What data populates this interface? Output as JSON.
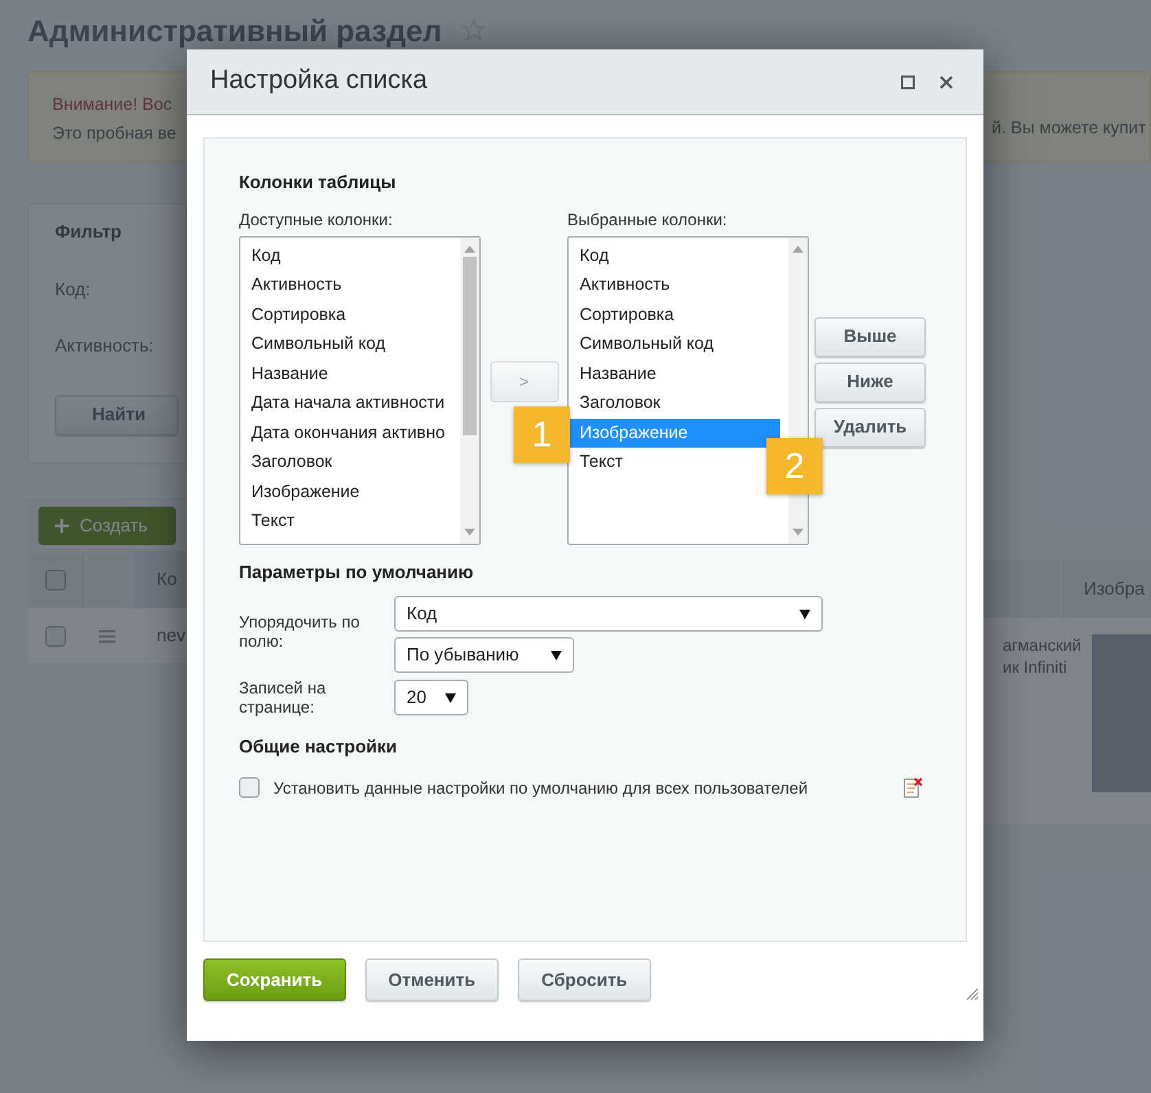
{
  "page": {
    "title": "Административный раздел",
    "warning": {
      "heading": "Внимание! Вос",
      "text": "Это пробная ве",
      "text_right": "й. Вы можете купит"
    },
    "filter": {
      "tab": "Фильтр",
      "fields": [
        "Код:",
        "Активность:"
      ],
      "find_button": "Найти"
    },
    "create_button": "Создать",
    "table": {
      "header_checkbox": {
        "checked": false
      },
      "columns": [
        {
          "label": "Ко"
        },
        {
          "label": "Изобра"
        }
      ],
      "rows": [
        {
          "checked": false,
          "column_1": "nev",
          "column_2": [
            "агманский",
            "ик Infiniti"
          ]
        }
      ]
    }
  },
  "dialog": {
    "title": "Настройка списка",
    "columns_heading": "Колонки таблицы",
    "available": {
      "label": "Доступные колонки:",
      "items": [
        {
          "label": "Код",
          "selected": false
        },
        {
          "label": "Активность",
          "selected": false
        },
        {
          "label": "Сортировка",
          "selected": false
        },
        {
          "label": "Символьный код",
          "selected": false
        },
        {
          "label": "Название",
          "selected": false
        },
        {
          "label": "Дата начала активности",
          "selected": false
        },
        {
          "label": "Дата окончания активно",
          "selected": false
        },
        {
          "label": "Заголовок",
          "selected": false
        },
        {
          "label": "Изображение",
          "selected": false
        },
        {
          "label": "Текст",
          "selected": false
        }
      ]
    },
    "add_button": ">",
    "chosen": {
      "label": "Выбранные колонки:",
      "items": [
        {
          "label": "Код",
          "selected": false
        },
        {
          "label": "Активность",
          "selected": false
        },
        {
          "label": "Сортировка",
          "selected": false
        },
        {
          "label": "Символьный код",
          "selected": false
        },
        {
          "label": "Название",
          "selected": false
        },
        {
          "label": "Заголовок",
          "selected": false
        },
        {
          "label": "Изображение",
          "selected": true
        },
        {
          "label": "Текст",
          "selected": false
        }
      ]
    },
    "move_buttons": [
      "Выше",
      "Ниже",
      "Удалить"
    ],
    "defaults": {
      "heading": "Параметры по умолчанию",
      "sort_label": "Упорядочить по полю:",
      "sort_field": "Код",
      "sort_order": "По убыванию",
      "page_size_label": "Записей на странице:",
      "page_size": "20"
    },
    "general": {
      "heading": "Общие настройки",
      "checkbox": {
        "label": "Установить данные настройки по умолчанию для всех пользователей",
        "checked": false
      }
    },
    "footer_buttons": [
      {
        "label": "Сохранить",
        "kind": "primary"
      },
      {
        "label": "Отменить",
        "kind": "secondary"
      },
      {
        "label": "Сбросить",
        "kind": "secondary"
      }
    ],
    "annotations": [
      {
        "label": "1"
      },
      {
        "label": "2"
      }
    ]
  }
}
